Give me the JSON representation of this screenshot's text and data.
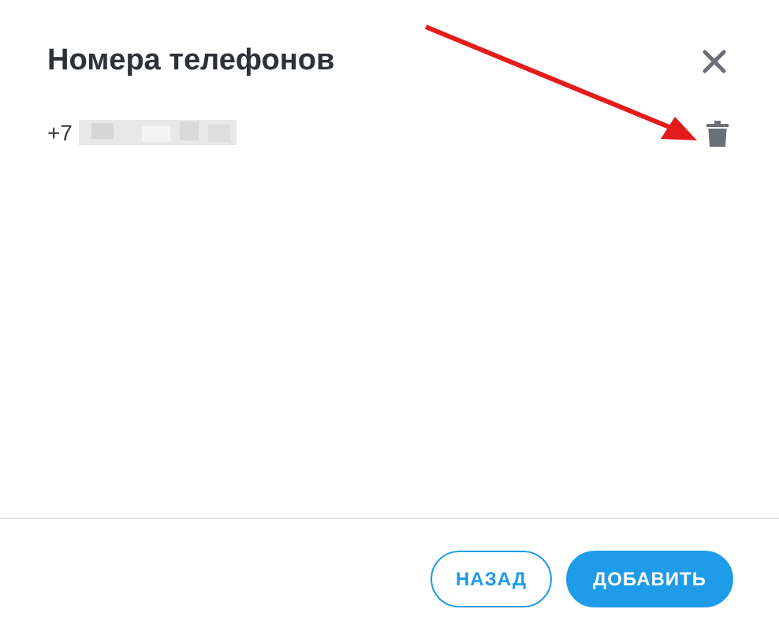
{
  "dialog": {
    "title": "Номера телефонов"
  },
  "phones": [
    {
      "number": "+7"
    }
  ],
  "buttons": [
    {
      "label": "НАЗАД",
      "kind": "outline"
    },
    {
      "label": "ДОБАВИТЬ",
      "kind": "primary"
    }
  ]
}
